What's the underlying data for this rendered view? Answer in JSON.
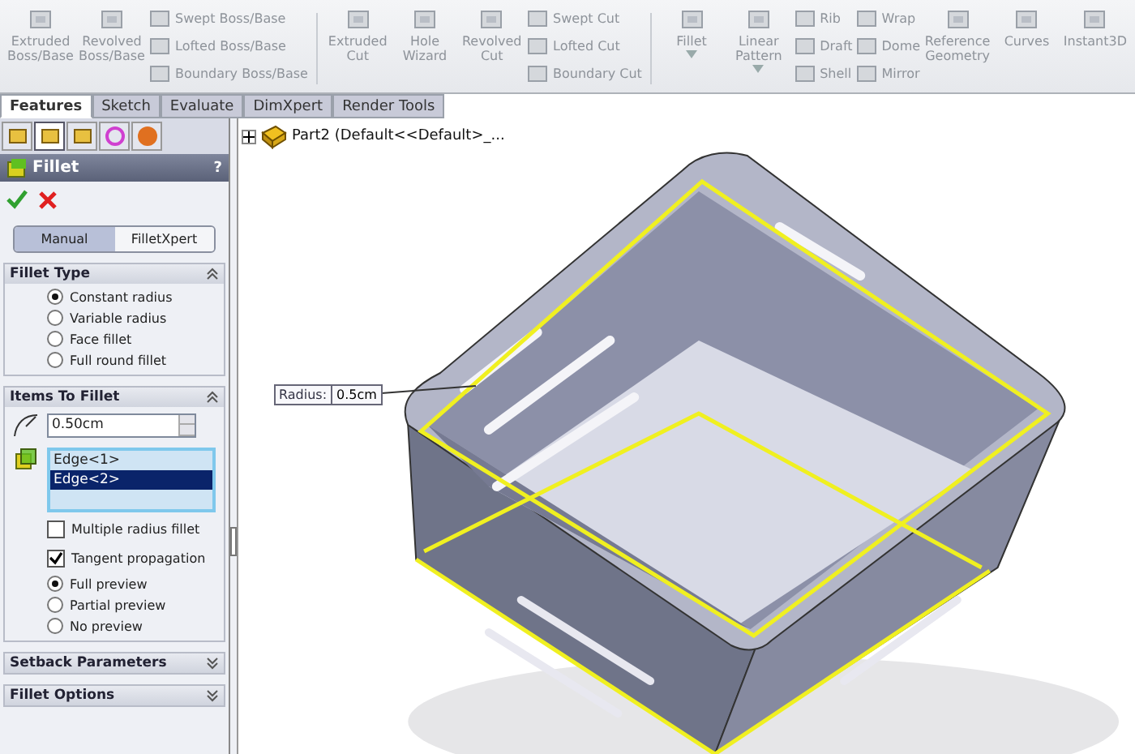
{
  "toolbar": {
    "disabled": true,
    "items": [
      {
        "kind": "large",
        "label": "Extruded Boss/Base",
        "has_menu": false
      },
      {
        "kind": "large",
        "label": "Revolved Boss/Base",
        "has_menu": false
      },
      {
        "kind": "stack",
        "items": [
          "Swept Boss/Base",
          "Lofted Boss/Base",
          "Boundary Boss/Base"
        ]
      },
      {
        "kind": "separator"
      },
      {
        "kind": "large",
        "label": "Extruded Cut",
        "has_menu": false
      },
      {
        "kind": "large",
        "label": "Hole Wizard",
        "has_menu": false
      },
      {
        "kind": "large",
        "label": "Revolved Cut",
        "has_menu": false
      },
      {
        "kind": "stack",
        "items": [
          "Swept Cut",
          "Lofted Cut",
          "Boundary Cut"
        ]
      },
      {
        "kind": "separator"
      },
      {
        "kind": "large",
        "label": "Fillet",
        "has_menu": true
      },
      {
        "kind": "large",
        "label": "Linear Pattern",
        "has_menu": true
      },
      {
        "kind": "stack",
        "items": [
          "Rib",
          "Draft",
          "Shell"
        ]
      },
      {
        "kind": "stack",
        "items": [
          "Wrap",
          "Dome",
          "Mirror"
        ]
      },
      {
        "kind": "large",
        "label": "Reference Geometry",
        "has_menu": false
      },
      {
        "kind": "large",
        "label": "Curves",
        "has_menu": false
      },
      {
        "kind": "large",
        "label": "Instant3D",
        "has_menu": false
      }
    ]
  },
  "tabs": [
    {
      "label": "Features",
      "selected": true
    },
    {
      "label": "Sketch",
      "selected": false
    },
    {
      "label": "Evaluate",
      "selected": false
    },
    {
      "label": "DimXpert",
      "selected": false
    },
    {
      "label": "Render Tools",
      "selected": false
    }
  ],
  "manager_tabs": [
    {
      "selected": false
    },
    {
      "selected": true
    },
    {
      "selected": false
    },
    {
      "selected": false
    },
    {
      "selected": false
    }
  ],
  "property_manager": {
    "title": "Fillet",
    "help": "?",
    "modes": [
      {
        "label": "Manual",
        "selected": true
      },
      {
        "label": "FilletXpert",
        "selected": false
      }
    ],
    "sections": [
      {
        "title": "Fillet Type",
        "expanded": true,
        "controls": [
          {
            "kind": "radio",
            "label": "Constant radius",
            "selected": true
          },
          {
            "kind": "radio",
            "label": "Variable radius",
            "selected": false
          },
          {
            "kind": "radio",
            "label": "Face fillet",
            "selected": false
          },
          {
            "kind": "radio",
            "label": "Full round fillet",
            "selected": false
          }
        ]
      },
      {
        "title": "Items To Fillet",
        "expanded": true,
        "controls": [
          {
            "kind": "spin",
            "value": "0.50cm"
          },
          {
            "kind": "list",
            "items": [
              {
                "label": "Edge<1>",
                "selected": false
              },
              {
                "label": "Edge<2>",
                "selected": true
              }
            ]
          },
          {
            "kind": "checkbox",
            "label": "Multiple radius fillet",
            "checked": false
          },
          {
            "kind": "checkbox",
            "label": "Tangent propagation",
            "checked": true
          },
          {
            "kind": "radio",
            "label": "Full preview",
            "selected": true
          },
          {
            "kind": "radio",
            "label": "Partial preview",
            "selected": false
          },
          {
            "kind": "radio",
            "label": "No preview",
            "selected": false
          }
        ]
      },
      {
        "title": "Setback Parameters",
        "expanded": false
      },
      {
        "title": "Fillet Options",
        "expanded": false
      }
    ]
  },
  "tree": {
    "label": "Part2  (Default<<Default>_...",
    "expanded": false
  },
  "callout": {
    "label": "Radius:",
    "value": "0.5cm"
  }
}
